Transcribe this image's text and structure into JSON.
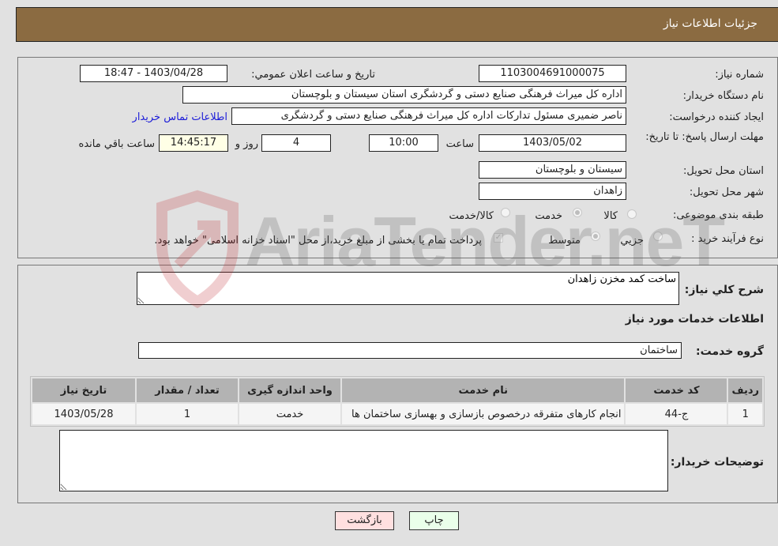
{
  "header": {
    "title": "جزئیات اطلاعات نیاز"
  },
  "form": {
    "need_number": {
      "label": "شماره نیاز:",
      "value": "1103004691000075"
    },
    "announce_datetime": {
      "label": "تاریخ و ساعت اعلان عمومي:",
      "value": "1403/04/28 - 18:47"
    },
    "buyer_org": {
      "label": "نام دستگاه خريدار:",
      "value": "اداره کل میراث فرهنگی  صنایع دستی و گردشگری استان سیستان و بلوچستان"
    },
    "requester": {
      "label": "ايجاد كننده درخواست:",
      "value": "ناصر ضمیری مسئول تداركات اداره کل میراث فرهنگی  صنایع دستی و گردشگری",
      "contact_link": "اطلاعات تماس خريدار"
    },
    "deadline": {
      "label": "مهلت ارسال پاسخ: تا تاریخ:",
      "date": "1403/05/02",
      "time_label": "ساعت",
      "time": "10:00",
      "days": "4",
      "days_label": "روز و",
      "remaining": "14:45:17",
      "remaining_label": "ساعت باقي مانده"
    },
    "province": {
      "label": "استان محل تحویل:",
      "value": "سیستان و بلوچستان"
    },
    "city": {
      "label": "شهر محل تحویل:",
      "value": "زاهدان"
    },
    "category": {
      "label": "طبقه بندی موضوعی:",
      "options": [
        "کالا",
        "خدمت",
        "کالا/خدمت"
      ],
      "selected": "خدمت"
    },
    "purchase_type": {
      "label": "نوع فرآيند خريد :",
      "options": [
        "جزيي",
        "متوسط"
      ],
      "selected": "متوسط",
      "treasury_note": "پرداخت تمام يا بخشی از مبلغ خريد،از محل \"اسناد خزانه اسلامی\" خواهد بود.",
      "treasury_checked": true
    }
  },
  "details": {
    "description_label": "شرح کلي نياز:",
    "description": "ساخت کمد مخزن زاهدان",
    "services_heading": "اطلاعات خدمات مورد نياز",
    "service_group_label": "گروه خدمت:",
    "service_group": "ساختمان",
    "table": {
      "headers": [
        "رديف",
        "کد خدمت",
        "نام خدمت",
        "واحد اندازه گيری",
        "تعداد / مقدار",
        "تاريخ نياز"
      ],
      "rows": [
        [
          "1",
          "ج-44",
          "انجام کارهای متفرقه درخصوص بازسازی و بهسازی ساختمان ها",
          "خدمت",
          "1",
          "1403/05/28"
        ]
      ]
    },
    "buyer_notes_label": "توضيحات خريدار:",
    "buyer_notes": ""
  },
  "buttons": {
    "print": "چاپ",
    "back": "بازگشت"
  },
  "colors": {
    "header": "#8b6b41",
    "print_bg": "#eaffea",
    "back_bg": "#ffe0e0",
    "link": "#1c1cd8"
  },
  "watermark": "AriaTender.neT"
}
